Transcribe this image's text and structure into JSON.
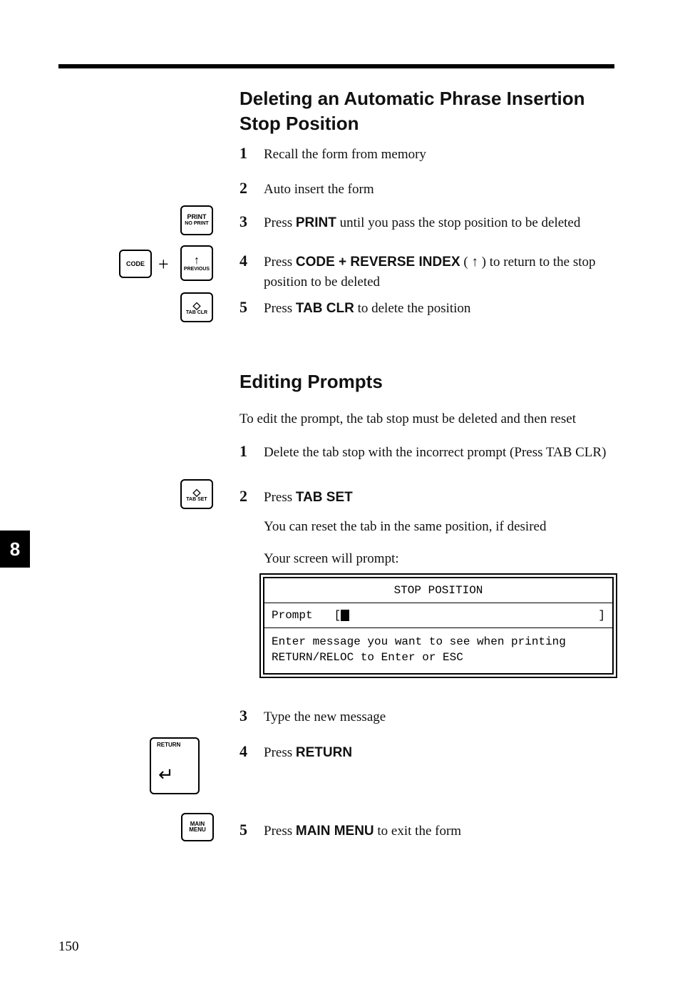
{
  "page_number": "150",
  "side_tab": "8",
  "section1": {
    "title": "Deleting an Automatic Phrase Insertion Stop Position",
    "steps": [
      {
        "num": "1",
        "text": "Recall the form from memory"
      },
      {
        "num": "2",
        "text": "Auto insert the form"
      },
      {
        "num": "3",
        "prefix": "Press ",
        "key": "PRINT",
        "suffix": " until you pass the stop position to be deleted"
      },
      {
        "num": "4",
        "prefix": "Press ",
        "key": "CODE + REVERSE INDEX",
        "mid": " ( ↑ ) to return to the stop position to be deleted"
      },
      {
        "num": "5",
        "prefix": "Press ",
        "key": "TAB CLR",
        "suffix": " to delete the position"
      }
    ]
  },
  "section2": {
    "title": "Editing Prompts",
    "intro": "To edit the prompt, the tab stop must be deleted and then reset",
    "steps": [
      {
        "num": "1",
        "text": "Delete the tab stop with the incorrect prompt (Press TAB CLR)"
      },
      {
        "num": "2",
        "prefix": "Press ",
        "key": "TAB SET"
      },
      {
        "num": "3",
        "text": "Type the new message"
      },
      {
        "num": "4",
        "prefix": "Press ",
        "key": "RETURN"
      },
      {
        "num": "5",
        "prefix": "Press ",
        "key": "MAIN MENU",
        "suffix": " to exit the form"
      }
    ],
    "sub_after_step2_a": "You can reset the tab in the same position, if desired",
    "sub_after_step2_b": "Your screen will prompt:"
  },
  "screen": {
    "header": "STOP POSITION",
    "prompt_label": "Prompt",
    "prompt_left_bracket": "[",
    "prompt_right_bracket": "]",
    "msg_line1": "Enter message you want to see when printing",
    "msg_line2": "RETURN/RELOC to Enter or ESC"
  },
  "keycaps": {
    "print_top": "PRINT",
    "print_bottom": "NO PRINT",
    "code": "CODE",
    "plus": "+",
    "revindex_glyph": "↑",
    "revindex_label": "PREVIOUS",
    "tabclr_glyph": "◇",
    "tabclr_label": "TAB CLR",
    "tabset_glyph": "◇",
    "tabset_label": "TAB SET",
    "return_label": "RETURN",
    "return_glyph": "↵",
    "mainmenu_top": "MAIN",
    "mainmenu_bottom": "MENU"
  }
}
